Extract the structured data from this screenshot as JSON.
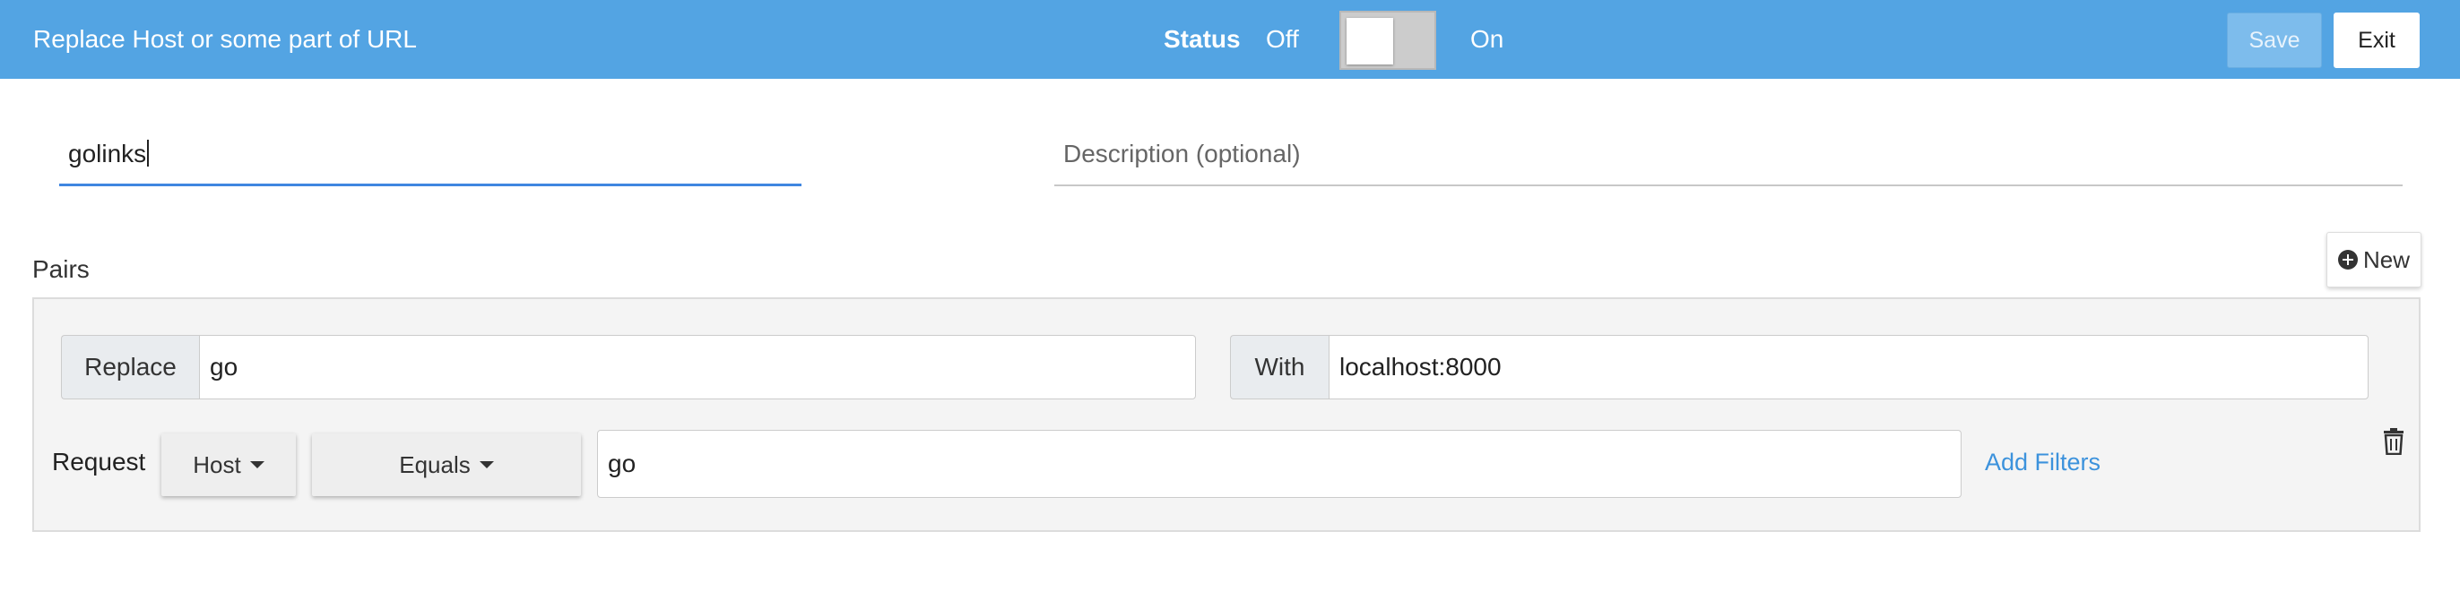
{
  "header": {
    "title": "Replace Host or some part of URL",
    "status_label": "Status",
    "status_off": "Off",
    "status_on": "On",
    "toggle_state": "off",
    "save_label": "Save",
    "exit_label": "Exit",
    "colors": {
      "bar": "#53a4e3",
      "save_bg": "#7dbcec"
    }
  },
  "form": {
    "name_value": "golinks",
    "description_placeholder": "Description (optional)"
  },
  "pairs": {
    "label": "Pairs",
    "new_label": "New",
    "new_icon": "plus-circle-icon",
    "items": [
      {
        "replace_label": "Replace",
        "replace_value": "go",
        "with_label": "With",
        "with_value": "localhost:8000",
        "request_label": "Request",
        "source_select": "Host",
        "operator_select": "Equals",
        "filter_value": "go",
        "add_filters_label": "Add Filters",
        "delete_icon": "trash-icon"
      }
    ]
  }
}
